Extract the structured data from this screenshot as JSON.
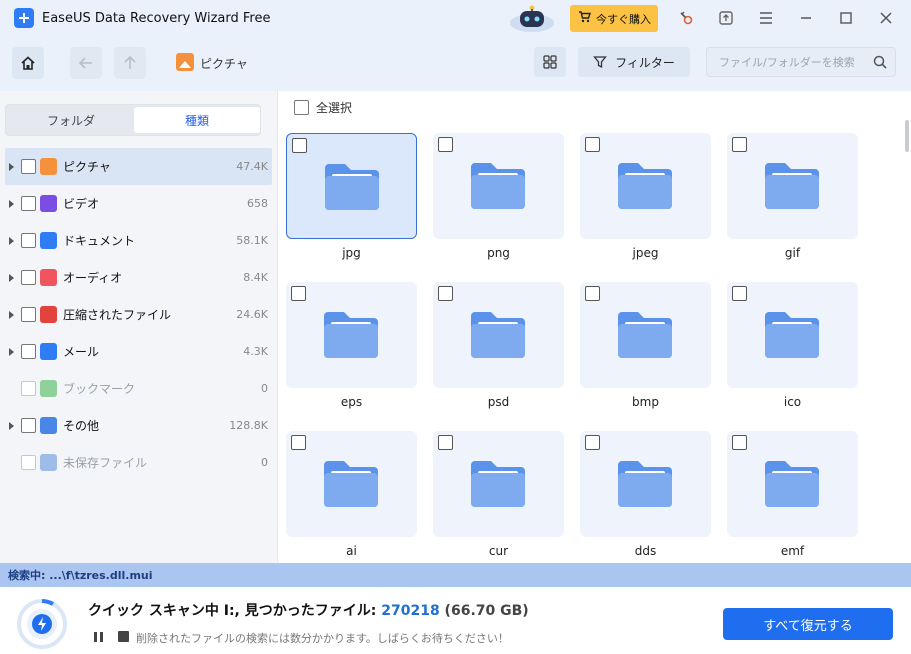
{
  "app": {
    "title": "EaseUS Data Recovery Wizard Free",
    "buy_label": "今すぐ購入"
  },
  "toolbar": {
    "breadcrumb": "ピクチャ",
    "filter_label": "フィルター",
    "search_placeholder": "ファイル/フォルダーを検索"
  },
  "sidebar": {
    "tabs": [
      {
        "label": "フォルダ",
        "active": false
      },
      {
        "label": "種類",
        "active": true
      }
    ],
    "items": [
      {
        "label": "ピクチャ",
        "count": "47.4K",
        "icon": "picture-icon",
        "color": "#f5913b",
        "expandable": true,
        "selected": true,
        "disabled": false
      },
      {
        "label": "ビデオ",
        "count": "658",
        "icon": "video-icon",
        "color": "#7b4de3",
        "expandable": true,
        "selected": false,
        "disabled": false
      },
      {
        "label": "ドキュメント",
        "count": "58.1K",
        "icon": "document-icon",
        "color": "#2f7df6",
        "expandable": true,
        "selected": false,
        "disabled": false
      },
      {
        "label": "オーディオ",
        "count": "8.4K",
        "icon": "audio-icon",
        "color": "#f0555f",
        "expandable": true,
        "selected": false,
        "disabled": false
      },
      {
        "label": "圧縮されたファイル",
        "count": "24.6K",
        "icon": "archive-icon",
        "color": "#e2433d",
        "expandable": true,
        "selected": false,
        "disabled": false
      },
      {
        "label": "メール",
        "count": "4.3K",
        "icon": "mail-icon",
        "color": "#2f7df6",
        "expandable": true,
        "selected": false,
        "disabled": false
      },
      {
        "label": "ブックマーク",
        "count": "0",
        "icon": "bookmark-icon",
        "color": "#8fd19a",
        "expandable": false,
        "selected": false,
        "disabled": true
      },
      {
        "label": "その他",
        "count": "128.8K",
        "icon": "other-icon",
        "color": "#4a86e8",
        "expandable": true,
        "selected": false,
        "disabled": false
      },
      {
        "label": "未保存ファイル",
        "count": "0",
        "icon": "unsaved-icon",
        "color": "#9fbce8",
        "expandable": false,
        "selected": false,
        "disabled": true
      }
    ]
  },
  "main": {
    "select_all_label": "全選択",
    "folders": [
      {
        "label": "jpg",
        "selected": true
      },
      {
        "label": "png",
        "selected": false
      },
      {
        "label": "jpeg",
        "selected": false
      },
      {
        "label": "gif",
        "selected": false
      },
      {
        "label": "eps",
        "selected": false
      },
      {
        "label": "psd",
        "selected": false
      },
      {
        "label": "bmp",
        "selected": false
      },
      {
        "label": "ico",
        "selected": false
      },
      {
        "label": "ai",
        "selected": false
      },
      {
        "label": "cur",
        "selected": false
      },
      {
        "label": "dds",
        "selected": false
      },
      {
        "label": "emf",
        "selected": false
      }
    ]
  },
  "status": {
    "searching_label": "検索中: ...\\f\\tzres.dll.mui"
  },
  "scan": {
    "title_prefix": "クイック スキャン中 I:,  見つかったファイル: ",
    "file_count": "270218",
    "size": " (66.70 GB)",
    "hint": "削除されたファイルの検索には数分かかります。しばらくお待ちください！",
    "recover_label": "すべて復元する"
  },
  "colors": {
    "accent": "#1f6ef0",
    "buy": "#fbc244",
    "status_strip": "#a9c5f0"
  }
}
